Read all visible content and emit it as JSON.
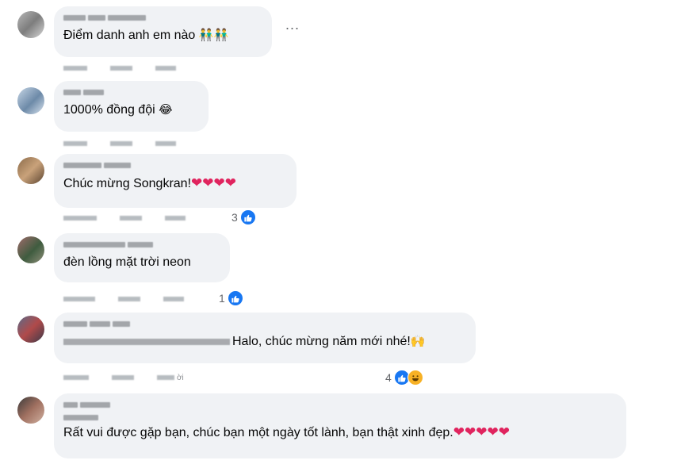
{
  "comments": [
    {
      "text": "Điểm danh anh em nào",
      "emoji": "👬👬",
      "reactions": null
    },
    {
      "text": "1000% đồng đội",
      "emoji": "😂",
      "reactions": null
    },
    {
      "text": "Chúc mừng Songkran!",
      "emoji": "❤❤❤❤",
      "reactions": {
        "count": "3",
        "types": [
          "like"
        ]
      }
    },
    {
      "text": "đèn lồng mặt trời neon",
      "emoji": "",
      "reactions": {
        "count": "1",
        "types": [
          "like"
        ]
      }
    },
    {
      "text": "Halo, chúc mừng năm mới nhé!",
      "emoji": "🙌",
      "reactions": {
        "count": "4",
        "types": [
          "like",
          "haha"
        ]
      },
      "action_suffix": "ời"
    },
    {
      "text": "Rất vui được gặp bạn, chúc bạn một ngày tốt lành, bạn thật xinh đẹp.",
      "emoji": "❤❤❤❤❤",
      "reactions": null
    }
  ],
  "more_menu": "...",
  "icons": {
    "like": "like-thumb-icon",
    "haha": "haha-face-icon",
    "more": "more-options-icon"
  },
  "colors": {
    "bubble": "#f0f2f5",
    "like": "#1877f2",
    "haha": "#f7b125",
    "heart": "#e0245e",
    "meta": "#65676b"
  }
}
